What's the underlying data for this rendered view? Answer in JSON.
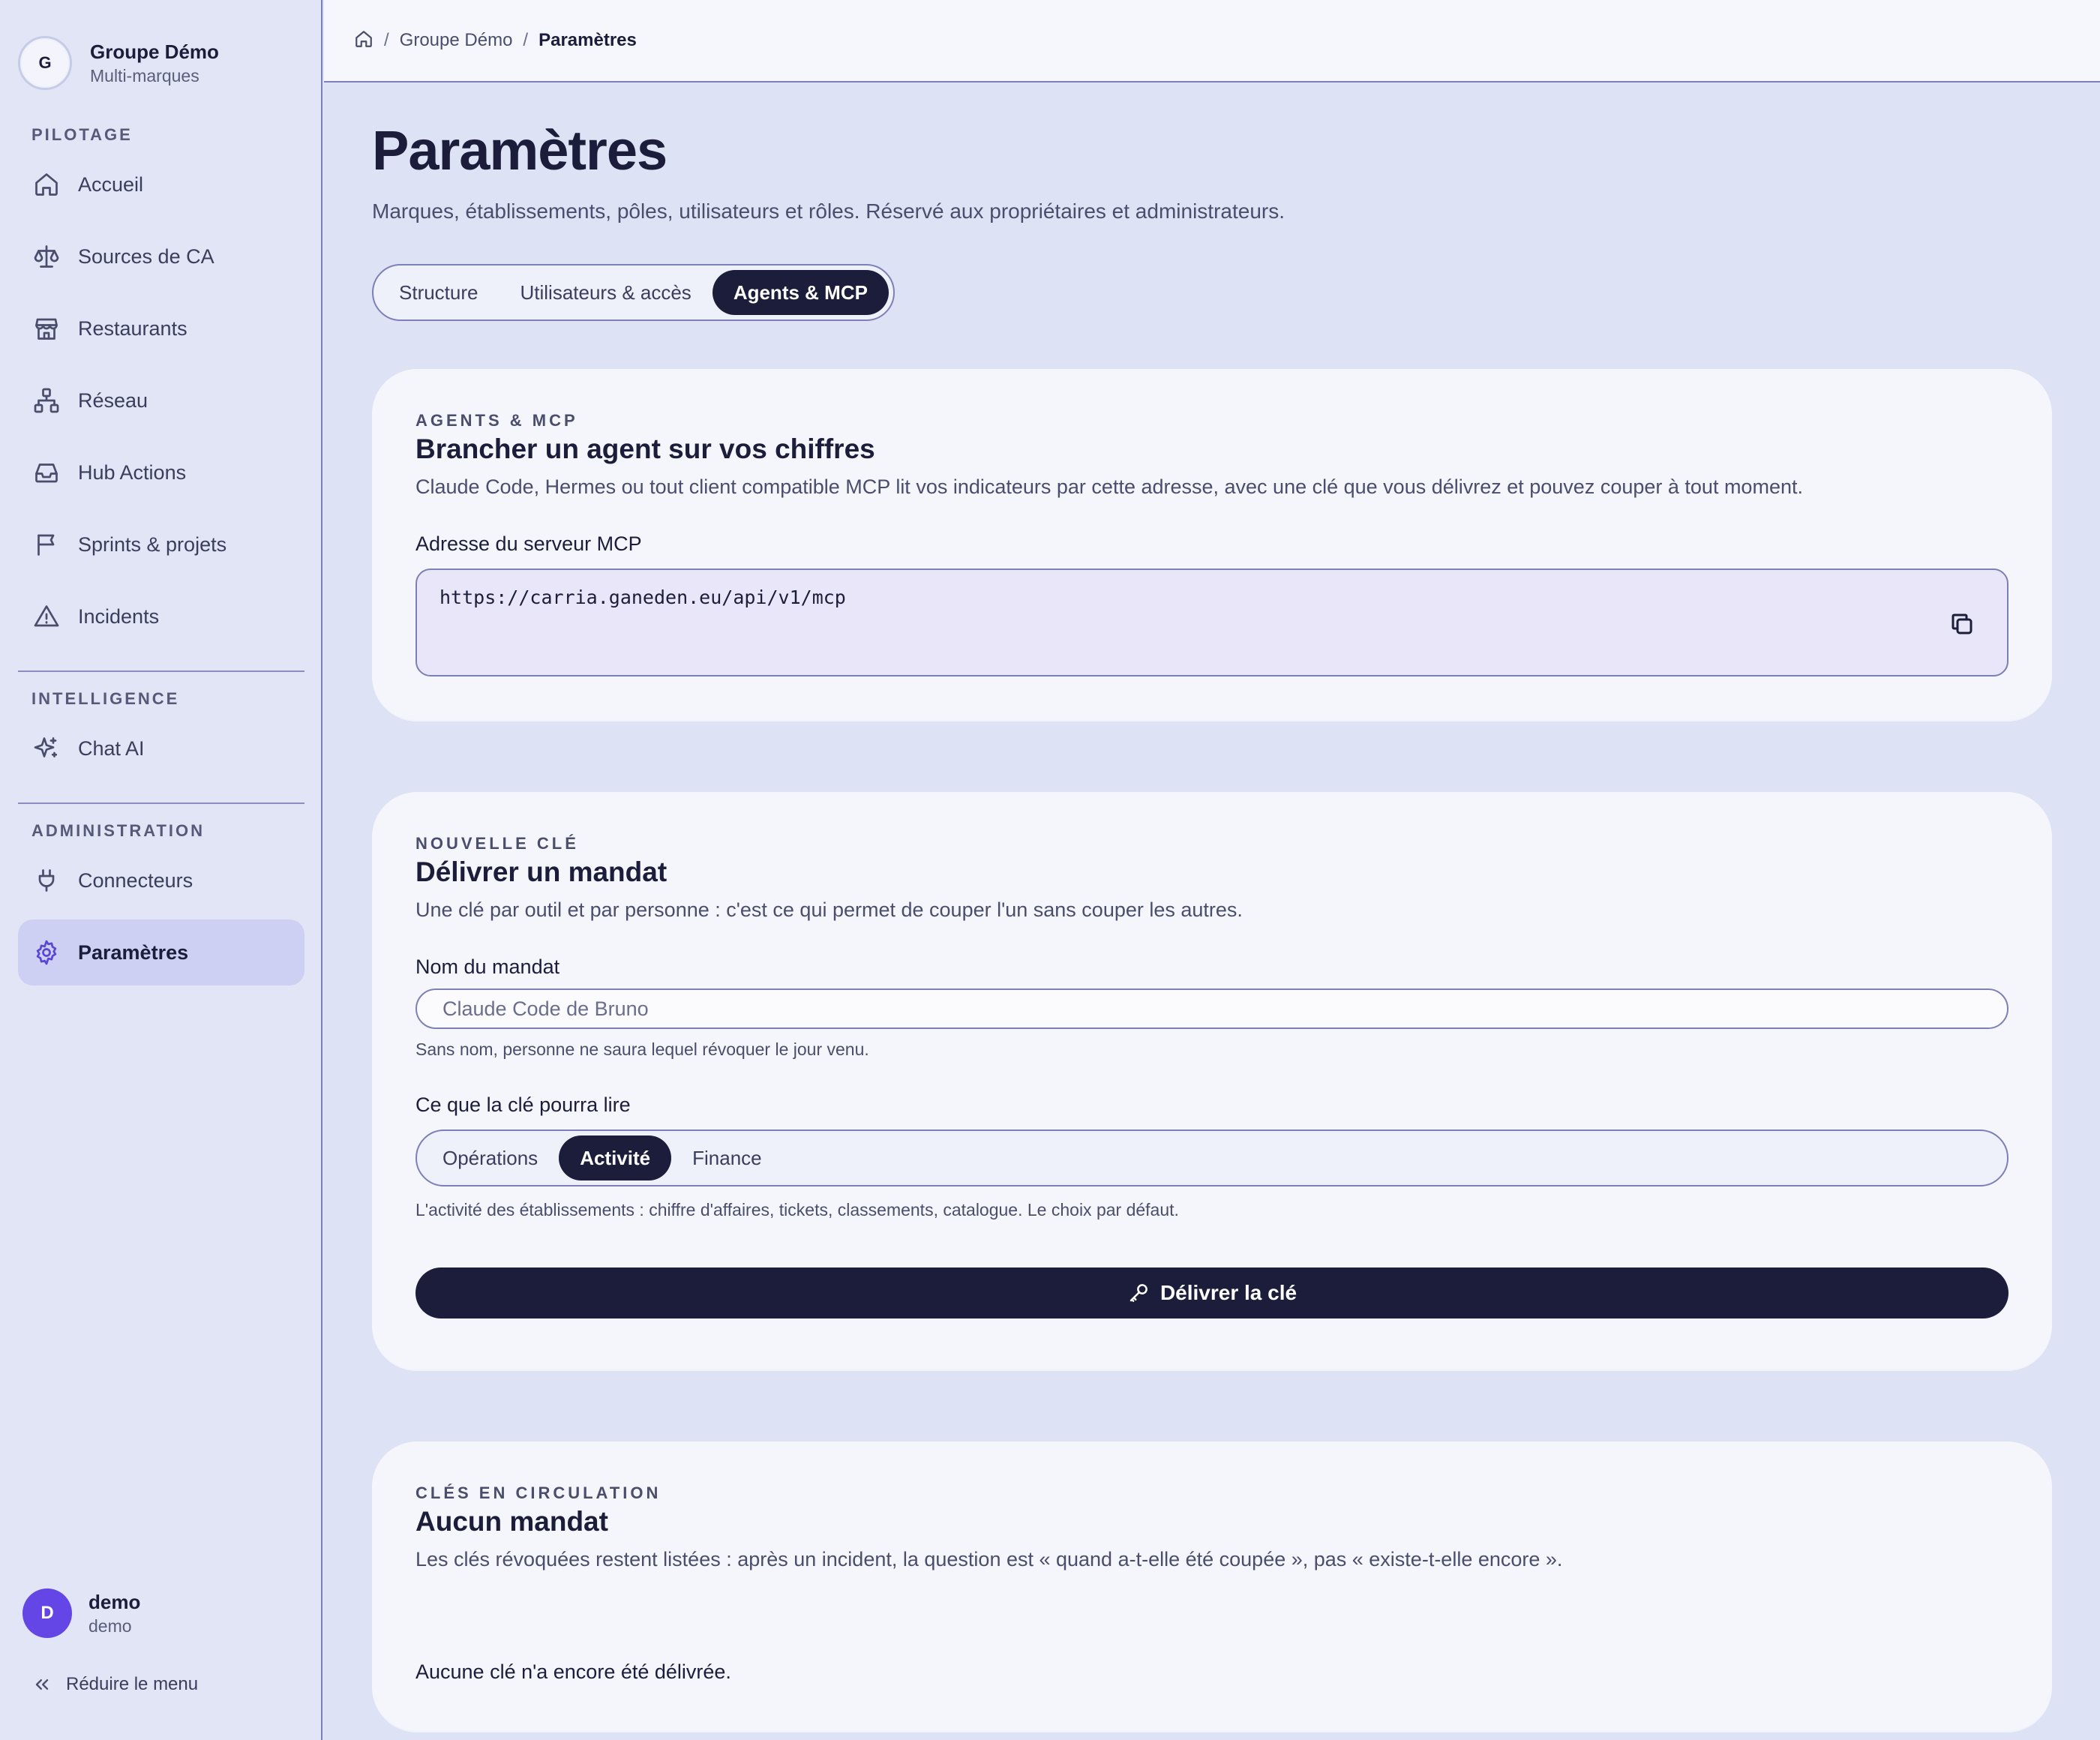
{
  "sidebar": {
    "org": {
      "initial": "G",
      "name": "Groupe Démo",
      "sub": "Multi-marques"
    },
    "sections": {
      "pilotage": "PILOTAGE",
      "intelligence": "INTELLIGENCE",
      "administration": "ADMINISTRATION"
    },
    "items": {
      "accueil": "Accueil",
      "sources": "Sources de CA",
      "restaurants": "Restaurants",
      "reseau": "Réseau",
      "hub": "Hub Actions",
      "sprints": "Sprints & projets",
      "incidents": "Incidents",
      "chat": "Chat AI",
      "connecteurs": "Connecteurs",
      "parametres": "Paramètres"
    },
    "user": {
      "initial": "D",
      "name": "demo",
      "sub": "demo"
    },
    "collapse_label": "Réduire le menu"
  },
  "breadcrumb": {
    "items": [
      "Groupe Démo",
      "Paramètres"
    ],
    "separator": "/"
  },
  "page": {
    "title": "Paramètres",
    "subtitle": "Marques, établissements, pôles, utilisateurs et rôles. Réservé aux propriétaires et administrateurs."
  },
  "tabs": [
    "Structure",
    "Utilisateurs & accès",
    "Agents & MCP"
  ],
  "active_tab": "Agents & MCP",
  "card_mcp": {
    "eyebrow": "AGENTS & MCP",
    "title": "Brancher un agent sur vos chiffres",
    "description": "Claude Code, Hermes ou tout client compatible MCP lit vos indicateurs par cette adresse, avec une clé que vous délivrez et pouvez couper à tout moment.",
    "field_label": "Adresse du serveur MCP",
    "url": "https://carria.ganeden.eu/api/v1/mcp"
  },
  "card_key": {
    "eyebrow": "NOUVELLE CLÉ",
    "title": "Délivrer un mandat",
    "description": "Une clé par outil et par personne : c'est ce qui permet de couper l'un sans couper les autres.",
    "name_label": "Nom du mandat",
    "name_placeholder": "Claude Code de Bruno",
    "name_helper": "Sans nom, personne ne saura lequel révoquer le jour venu.",
    "scope_label": "Ce que la clé pourra lire",
    "scope_options": [
      "Opérations",
      "Activité",
      "Finance"
    ],
    "scope_selected": "Activité",
    "scope_helper": "L'activité des établissements : chiffre d'affaires, tickets, classements, catalogue. Le choix par défaut.",
    "submit_label": "Délivrer la clé"
  },
  "card_list": {
    "eyebrow": "CLÉS EN CIRCULATION",
    "title": "Aucun mandat",
    "description": "Les clés révoquées restent listées : après un incident, la question est « quand a-t-elle été coupée », pas « existe-t-elle encore ».",
    "empty": "Aucune clé n'a encore été délivrée."
  },
  "colors": {
    "accent": "#1b1d3a",
    "active_nav": "#cdd0f2",
    "avatar": "#6445e6"
  },
  "icons": {
    "accueil": "home-icon",
    "sources": "scale-icon",
    "restaurants": "store-icon",
    "reseau": "network-icon",
    "hub": "inbox-icon",
    "sprints": "flag-icon",
    "incidents": "warning-icon",
    "chat": "sparkles-icon",
    "connecteurs": "plug-icon",
    "parametres": "gear-icon"
  }
}
